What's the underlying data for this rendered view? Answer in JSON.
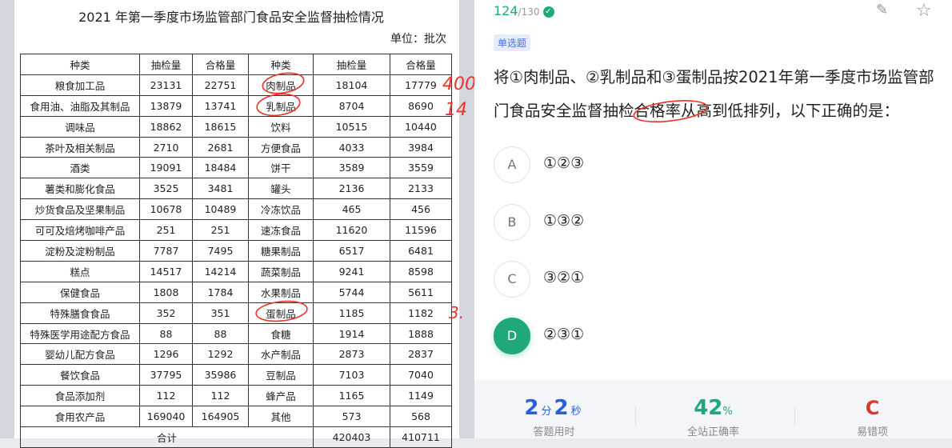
{
  "table": {
    "title": "2021 年第一季度市场监管部门食品安全监督抽检情况",
    "unit": "单位：批次",
    "headers": [
      "种类",
      "抽检量",
      "合格量",
      "种类",
      "抽检量",
      "合格量"
    ],
    "rows": [
      [
        "粮食加工品",
        "23131",
        "22751",
        "肉制品",
        "18104",
        "17779"
      ],
      [
        "食用油、油脂及其制品",
        "13879",
        "13741",
        "乳制品",
        "8704",
        "8690"
      ],
      [
        "调味品",
        "18862",
        "18615",
        "饮料",
        "10515",
        "10440"
      ],
      [
        "茶叶及相关制品",
        "2710",
        "2681",
        "方便食品",
        "4033",
        "3984"
      ],
      [
        "酒类",
        "19091",
        "18484",
        "饼干",
        "3589",
        "3559"
      ],
      [
        "薯类和膨化食品",
        "3525",
        "3481",
        "罐头",
        "2136",
        "2133"
      ],
      [
        "炒货食品及坚果制品",
        "10678",
        "10489",
        "冷冻饮品",
        "465",
        "456"
      ],
      [
        "可可及焙烤咖啡产品",
        "251",
        "251",
        "速冻食品",
        "11620",
        "11596"
      ],
      [
        "淀粉及淀粉制品",
        "7787",
        "7495",
        "糖果制品",
        "6517",
        "6481"
      ],
      [
        "糕点",
        "14517",
        "14214",
        "蔬菜制品",
        "9241",
        "8598"
      ],
      [
        "保健食品",
        "1808",
        "1784",
        "水果制品",
        "5744",
        "5611"
      ],
      [
        "特殊膳食食品",
        "352",
        "351",
        "蛋制品",
        "1185",
        "1182"
      ],
      [
        "特殊医学用途配方食品",
        "88",
        "88",
        "食糖",
        "1914",
        "1888"
      ],
      [
        "婴幼儿配方食品",
        "1296",
        "1292",
        "水产制品",
        "2873",
        "2837"
      ],
      [
        "餐饮食品",
        "37795",
        "35986",
        "豆制品",
        "7103",
        "7040"
      ],
      [
        "食品添加剂",
        "112",
        "112",
        "蜂产品",
        "1165",
        "1149"
      ],
      [
        "食用农产品",
        "169040",
        "164905",
        "其他",
        "573",
        "568"
      ]
    ],
    "total": {
      "label": "合计",
      "checked": "420403",
      "passed": "410711"
    }
  },
  "annotations": {
    "note_top": "400",
    "note_mid": "14",
    "note_bottom": "3."
  },
  "question": {
    "progress_current": "124",
    "progress_total": "/130",
    "check_glyph": "✓",
    "edit_glyph": "✎",
    "star_glyph": "☆",
    "type_label": "单选题",
    "text": "将①肉制品、②乳制品和③蛋制品按2021年第一季度市场监管部门食品安全监督抽检合格率从高到低排列，以下正确的是：",
    "options": [
      {
        "letter": "A",
        "text": "①②③",
        "selected": false
      },
      {
        "letter": "B",
        "text": "①③②",
        "selected": false
      },
      {
        "letter": "C",
        "text": "③②①",
        "selected": false
      },
      {
        "letter": "D",
        "text": "②③①",
        "selected": true
      }
    ]
  },
  "stats": {
    "time_min": "2",
    "time_min_unit": "分",
    "time_sec": "2",
    "time_sec_unit": "秒",
    "time_label": "答题用时",
    "accuracy": "42",
    "accuracy_unit": "%",
    "accuracy_label": "全站正确率",
    "wrong_option": "C",
    "wrong_label": "易错项"
  },
  "colors": {
    "accent_green": "#1fa97a",
    "accent_blue": "#2a5fd9",
    "accent_red": "#d83a2c",
    "annotation_red": "#e8342a"
  }
}
